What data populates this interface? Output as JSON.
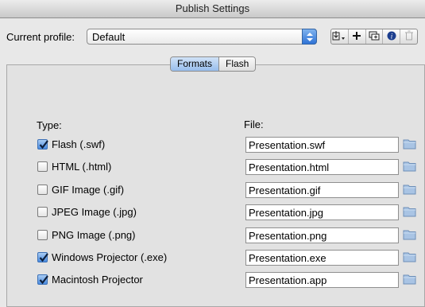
{
  "window": {
    "title": "Publish Settings"
  },
  "profile": {
    "label": "Current profile:",
    "value": "Default"
  },
  "toolbar": {
    "icons": [
      "import-export-icon",
      "add-icon",
      "duplicate-icon",
      "info-icon",
      "trash-icon"
    ]
  },
  "tabs": [
    {
      "label": "Formats",
      "active": true
    },
    {
      "label": "Flash",
      "active": false
    }
  ],
  "formats": {
    "type_header": "Type:",
    "file_header": "File:",
    "rows": [
      {
        "label": "Flash  (.swf)",
        "checked": true,
        "file": "Presentation.swf"
      },
      {
        "label": "HTML (.html)",
        "checked": false,
        "file": "Presentation.html"
      },
      {
        "label": "GIF Image (.gif)",
        "checked": false,
        "file": "Presentation.gif"
      },
      {
        "label": "JPEG Image (.jpg)",
        "checked": false,
        "file": "Presentation.jpg"
      },
      {
        "label": "PNG Image (.png)",
        "checked": false,
        "file": "Presentation.png"
      },
      {
        "label": "Windows Projector (.exe)",
        "checked": true,
        "file": "Presentation.exe"
      },
      {
        "label": "Macintosh Projector",
        "checked": true,
        "file": "Presentation.app"
      }
    ]
  },
  "colors": {
    "accent": "#3a7bd5",
    "folder": "#a9c4e4"
  }
}
